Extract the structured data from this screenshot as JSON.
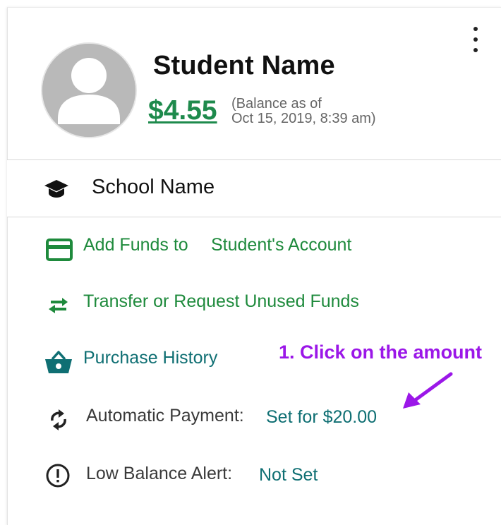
{
  "student": {
    "name": "Student Name",
    "balance": "$4.55",
    "balance_note_line1": "(Balance as of",
    "balance_note_line2": "Oct 15, 2019, 8:39 am)"
  },
  "school": {
    "name": "School Name",
    "icon": "graduation-cap-icon"
  },
  "menu": {
    "add_funds_prefix": "Add Funds to",
    "add_funds_target": "Student's Account",
    "transfer": "Transfer or Request Unused Funds",
    "purchase_history": "Purchase History",
    "auto_payment_label": "Automatic Payment:",
    "auto_payment_value": "Set for $20.00",
    "low_balance_label": "Low Balance Alert:",
    "low_balance_value": "Not Set"
  },
  "annotation": {
    "text": "1. Click on the amount",
    "color": "#9b17e8"
  },
  "colors": {
    "green": "#1e8a3c",
    "teal": "#0f6f73",
    "balance_green": "#1e8a4c"
  }
}
